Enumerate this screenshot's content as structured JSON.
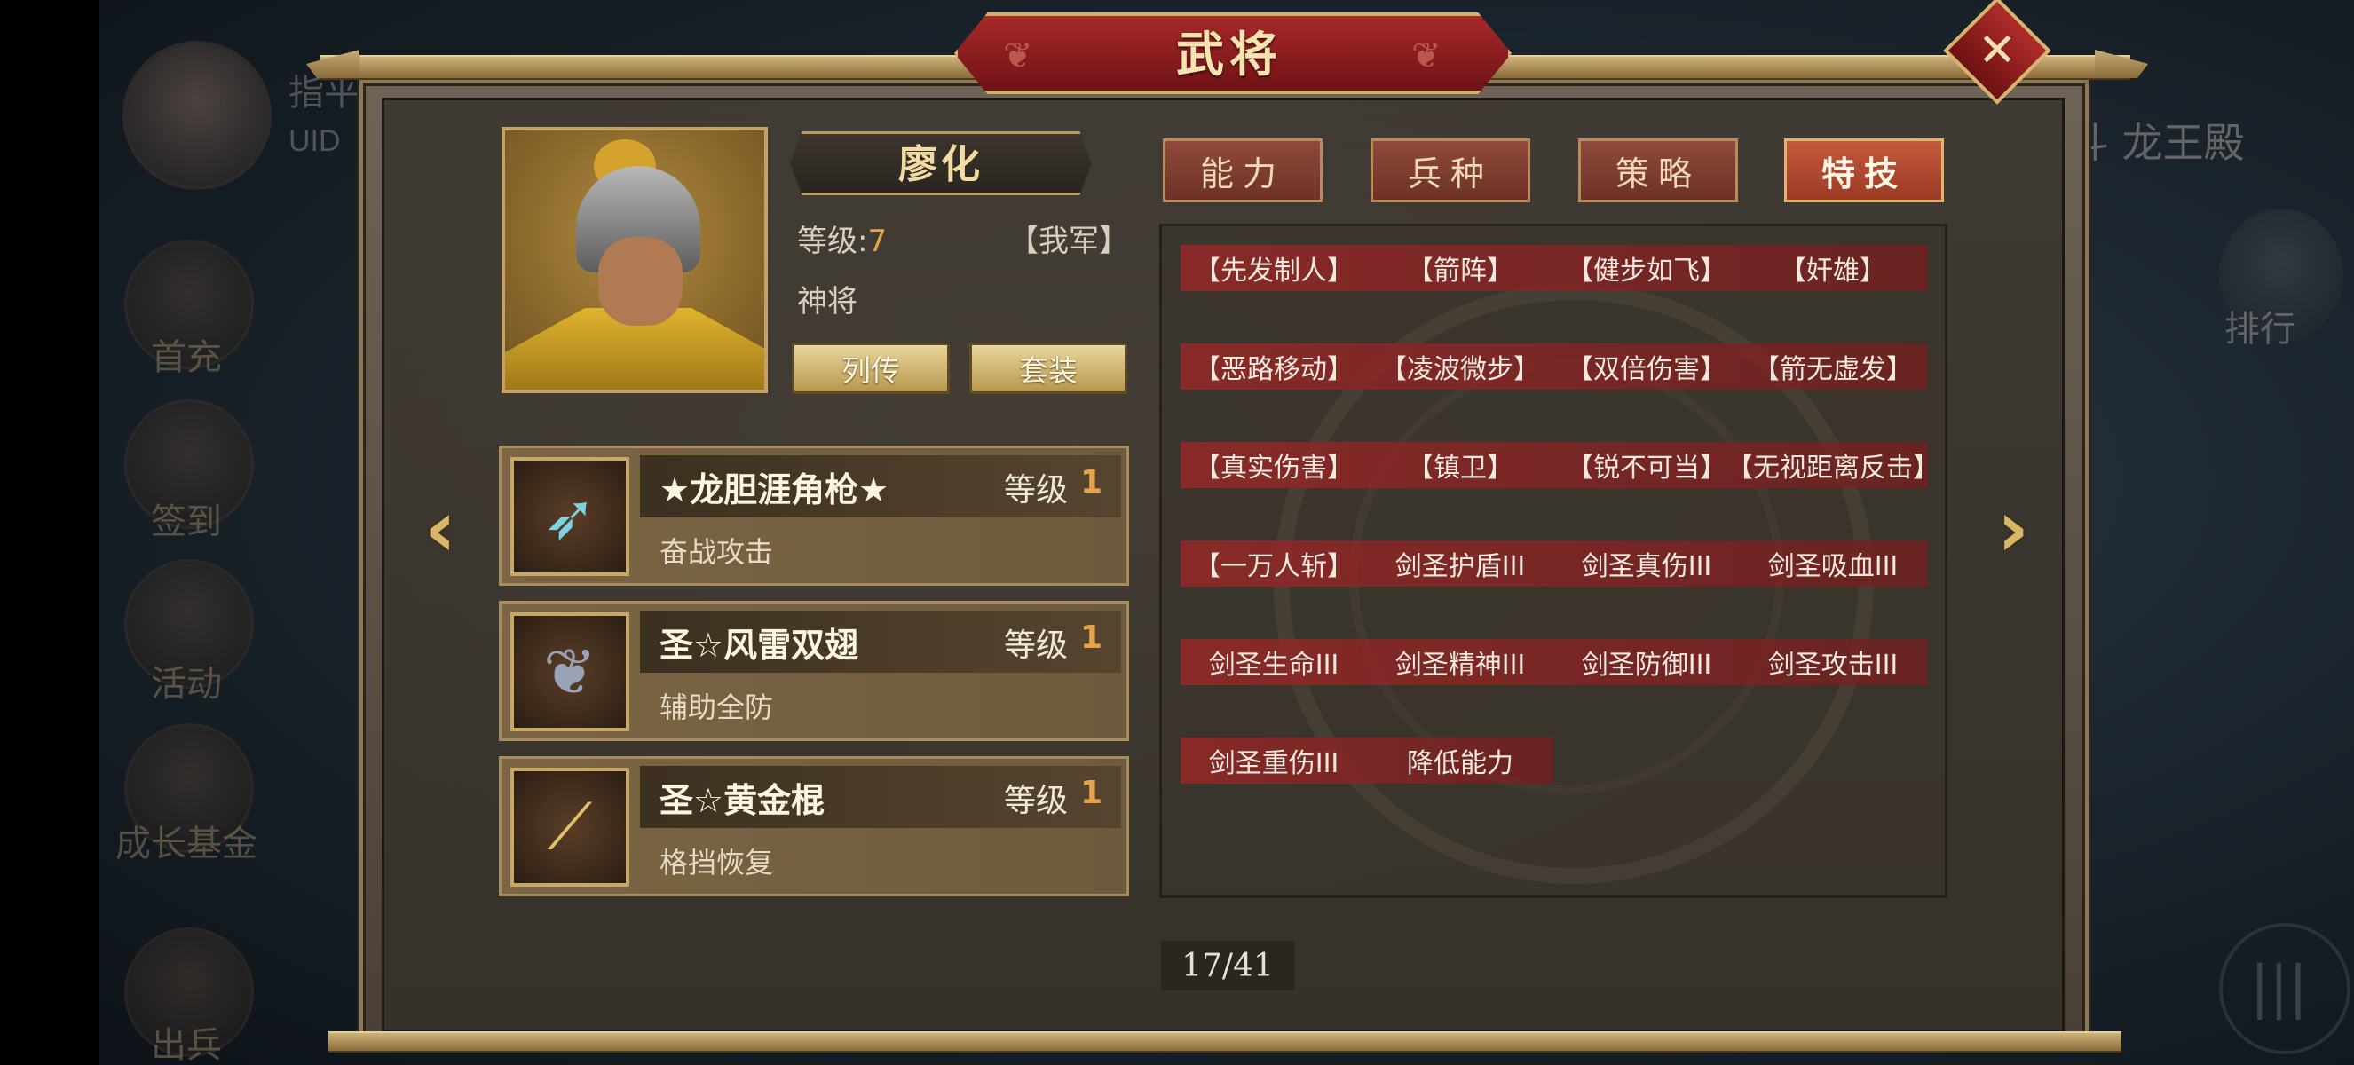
{
  "background": {
    "player_name": "指平",
    "uid_label": "UID",
    "left_menu": [
      "首充",
      "签到",
      "活动",
      "成长基金",
      "出兵"
    ],
    "right_title": "斗 龙王殿",
    "rank_label": "排行"
  },
  "panel": {
    "title": "武将",
    "close_symbol": "✕"
  },
  "general": {
    "name": "廖化",
    "level_label": "等级:",
    "level_value": "7",
    "faction": "【我军】",
    "rank": "神将",
    "buttons": {
      "biography": "列传",
      "set": "套装"
    }
  },
  "equipment": [
    {
      "name": "★龙胆涯角枪★",
      "level_label": "等级",
      "level": "1",
      "desc": "奋战攻击",
      "icon": "spear-icon"
    },
    {
      "name": "圣☆风雷双翅",
      "level_label": "等级",
      "level": "1",
      "desc": "辅助全防",
      "icon": "wings-icon"
    },
    {
      "name": "圣☆黄金棍",
      "level_label": "等级",
      "level": "1",
      "desc": "格挡恢复",
      "icon": "staff-icon"
    }
  ],
  "tabs": [
    "能力",
    "兵种",
    "策略",
    "特技"
  ],
  "active_tab": "特技",
  "skills": [
    [
      "【先发制人】",
      "【箭阵】",
      "【健步如飞】",
      "【奸雄】"
    ],
    [
      "【恶路移动】",
      "【凌波微步】",
      "【双倍伤害】",
      "【箭无虚发】"
    ],
    [
      "【真实伤害】",
      "【镇卫】",
      "【锐不可当】",
      "【无视距离反击】"
    ],
    [
      "【一万人斩】",
      "剑圣护盾III",
      "剑圣真伤III",
      "剑圣吸血III"
    ],
    [
      "剑圣生命III",
      "剑圣精神III",
      "剑圣防御III",
      "剑圣攻击III"
    ],
    [
      "剑圣重伤III",
      "降低能力"
    ]
  ],
  "pager": {
    "text": "17/41"
  },
  "arrows": {
    "prev": "‹",
    "next": "›"
  },
  "colors": {
    "accent_gold": "#d7b766",
    "skill_red": "#962828",
    "level_orange": "#e5a34b"
  }
}
